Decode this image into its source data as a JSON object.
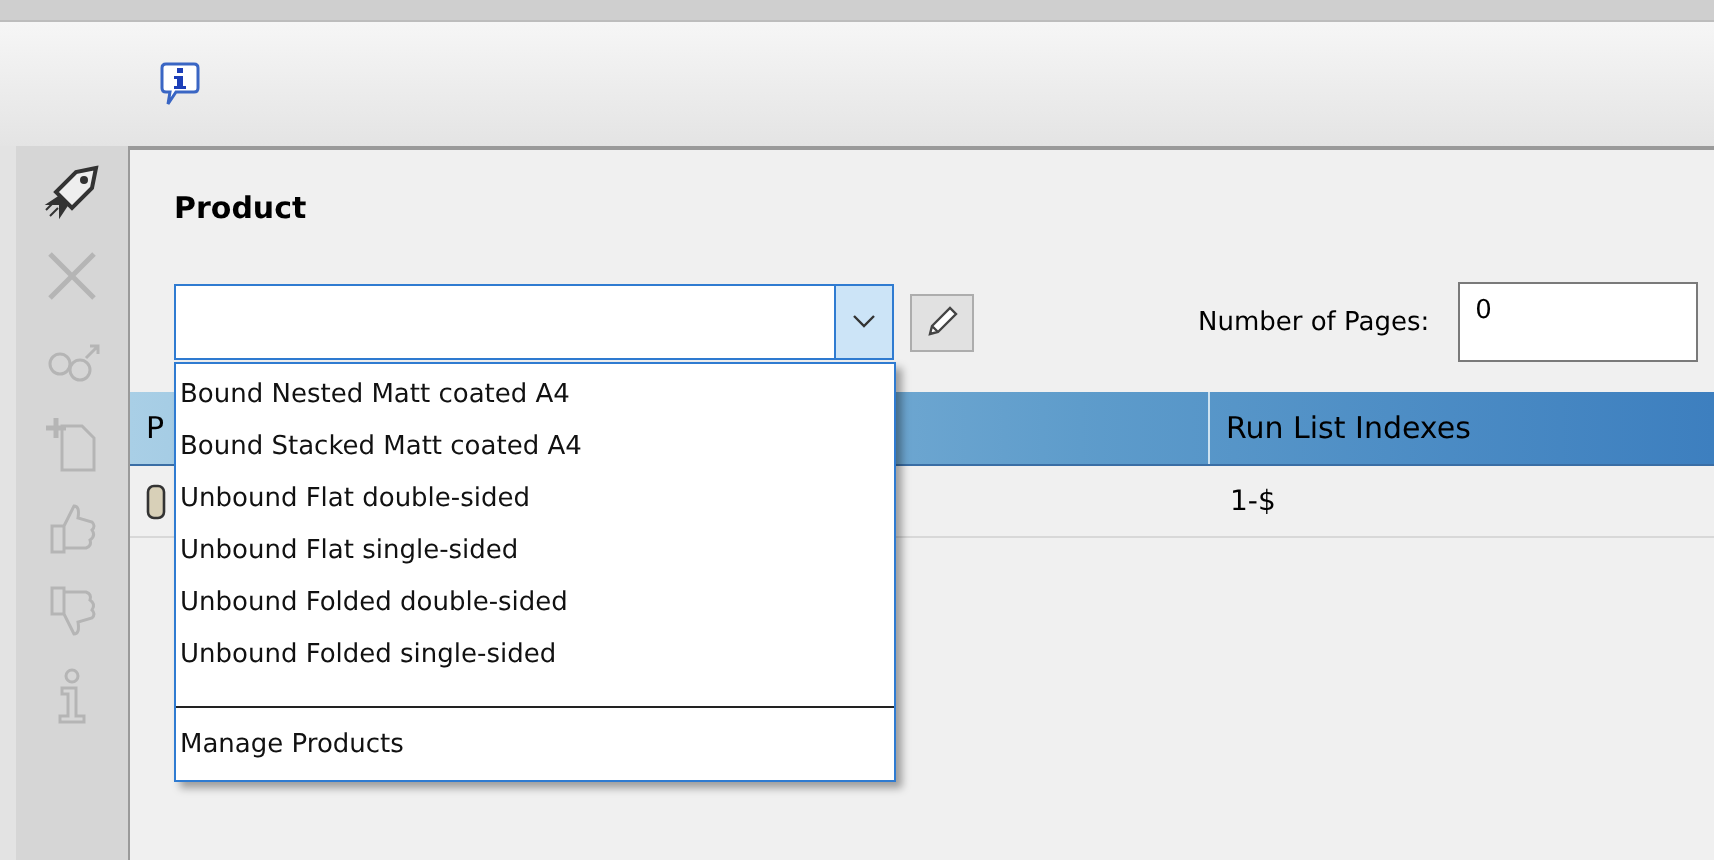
{
  "product_section": {
    "title": "Product",
    "combo": {
      "expanded": true
    },
    "options": [
      {
        "label": "Bound Nested Matt coated A4"
      },
      {
        "label": "Bound Stacked Matt coated A4"
      },
      {
        "label": "Unbound Flat double-sided"
      },
      {
        "label": "Unbound Flat single-sided"
      },
      {
        "label": "Unbound Folded double-sided"
      },
      {
        "label": "Unbound Folded single-sided"
      }
    ],
    "manage_entry": "Manage Products"
  },
  "pages": {
    "label": "Number of Pages:",
    "value": "0"
  },
  "table": {
    "columns": [
      "P",
      "Run List Indexes"
    ],
    "rows": [
      {
        "run_list_indexes": "1-$"
      }
    ]
  },
  "sidebar": {
    "items": [
      {
        "kind": "rocket",
        "disabled": false
      },
      {
        "kind": "close",
        "disabled": true
      },
      {
        "kind": "link",
        "disabled": true
      },
      {
        "kind": "new",
        "disabled": true
      },
      {
        "kind": "up",
        "disabled": true
      },
      {
        "kind": "down",
        "disabled": true
      },
      {
        "kind": "info",
        "disabled": true
      }
    ]
  }
}
